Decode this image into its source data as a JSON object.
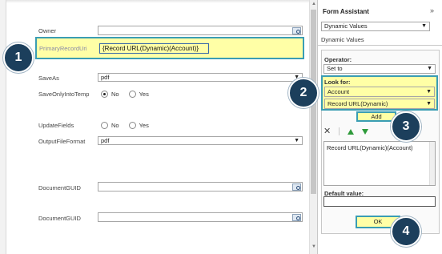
{
  "form": {
    "owner_label": "Owner",
    "primary_record_uri_label": "PrimaryRecordUri",
    "primary_record_uri_value": "{Record URL(Dynamic)(Account)}",
    "save_as_label": "SaveAs",
    "save_as_value": "pdf",
    "save_only_into_temp_label": "SaveOnlyIntoTemp",
    "update_fields_label": "UpdateFields",
    "output_file_format_label": "OutputFileFormat",
    "output_file_format_value": "pdf",
    "document_guid_label_1": "DocumentGUID",
    "document_guid_label_2": "DocumentGUID",
    "radio_no": "No",
    "radio_yes": "Yes"
  },
  "panel": {
    "title": "Form Assistant",
    "mode_select": "Dynamic Values",
    "section_tab": "Dynamic Values",
    "operator_label": "Operator:",
    "operator_value": "Set to",
    "look_for_label": "Look for:",
    "look_for_entity": "Account",
    "look_for_field": "Record URL(Dynamic)",
    "add_label": "Add",
    "values_text": "Record URL(Dynamic)(Account)",
    "default_value_label": "Default value:",
    "ok_label": "OK",
    "expand_glyph": "»"
  },
  "callouts": [
    "1",
    "2",
    "3",
    "4"
  ],
  "colors": {
    "highlight_fill": "#ffffa6",
    "highlight_border": "#3a9db3",
    "badge_fill": "#1c3f5c"
  }
}
